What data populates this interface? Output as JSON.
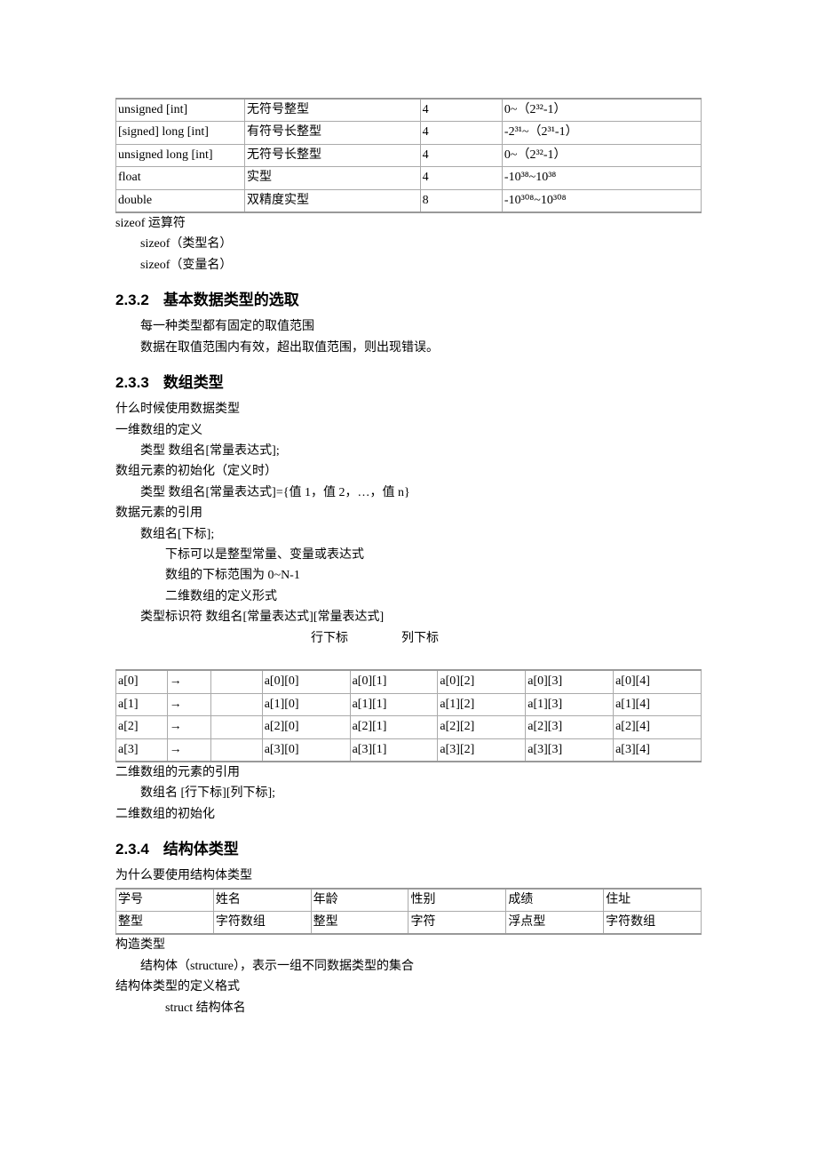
{
  "table1": {
    "rows": [
      {
        "c1": "unsigned [int]",
        "c2": "无符号整型",
        "c3": "4",
        "c4": "0~（2³²-1）"
      },
      {
        "c1": "[signed] long [int]",
        "c2": "有符号长整型",
        "c3": "4",
        "c4": "-2³¹~（2³¹-1）"
      },
      {
        "c1": "unsigned long [int]",
        "c2": "无符号长整型",
        "c3": "4",
        "c4": "0~（2³²-1）"
      },
      {
        "c1": "float",
        "c2": "实型",
        "c3": "4",
        "c4": "-10³⁸~10³⁸"
      },
      {
        "c1": "double",
        "c2": "双精度实型",
        "c3": "8",
        "c4": "-10³⁰⁸~10³⁰⁸"
      }
    ]
  },
  "sizeof": {
    "title": "sizeof 运算符",
    "l1": "sizeof（类型名）",
    "l2": "sizeof（变量名）"
  },
  "h232": {
    "num": "2.3.2",
    "title": "基本数据类型的选取"
  },
  "p232": {
    "l1": "每一种类型都有固定的取值范围",
    "l2": "数据在取值范围内有效，超出取值范围，则出现错误。"
  },
  "h233": {
    "num": "2.3.3",
    "title": "数组类型"
  },
  "p233": {
    "l1": "什么时候使用数据类型",
    "l2": "一维数组的定义",
    "l3": "类型  数组名[常量表达式];",
    "l4": "数组元素的初始化（定义时）",
    "l5": "类型  数组名[常量表达式]={值 1，值 2，…，值 n}",
    "l6": "数据元素的引用",
    "l7": "数组名[下标];",
    "l8": "下标可以是整型常量、变量或表达式",
    "l9": "数组的下标范围为 0~N-1",
    "l10": "二维数组的定义形式",
    "l11": "类型标识符  数组名[常量表达式][常量表达式]",
    "l12a": "行下标",
    "l12b": "列下标"
  },
  "table2": {
    "rows": [
      {
        "r": "a[0]",
        "a": "→",
        "c": [
          "a[0][0]",
          "a[0][1]",
          "a[0][2]",
          "a[0][3]",
          "a[0][4]"
        ]
      },
      {
        "r": "a[1]",
        "a": "→",
        "c": [
          "a[1][0]",
          "a[1][1]",
          "a[1][2]",
          "a[1][3]",
          "a[1][4]"
        ]
      },
      {
        "r": "a[2]",
        "a": "→",
        "c": [
          "a[2][0]",
          "a[2][1]",
          "a[2][2]",
          "a[2][3]",
          "a[2][4]"
        ]
      },
      {
        "r": "a[3]",
        "a": "→",
        "c": [
          "a[3][0]",
          "a[3][1]",
          "a[3][2]",
          "a[3][3]",
          "a[3][4]"
        ]
      }
    ]
  },
  "p233b": {
    "l1": "二维数组的元素的引用",
    "l2": "数组名  [行下标][列下标];",
    "l3": "二维数组的初始化"
  },
  "h234": {
    "num": "2.3.4",
    "title": "结构体类型"
  },
  "p234a": "为什么要使用结构体类型",
  "table3": {
    "header": [
      "学号",
      "姓名",
      "年龄",
      "性别",
      "成绩",
      "住址"
    ],
    "row": [
      "整型",
      "字符数组",
      "整型",
      "字符",
      "浮点型",
      "字符数组"
    ]
  },
  "p234b": {
    "l1": "构造类型",
    "l2": "结构体（structure），表示一组不同数据类型的集合",
    "l3": "结构体类型的定义格式",
    "l4": "struct  结构体名"
  }
}
